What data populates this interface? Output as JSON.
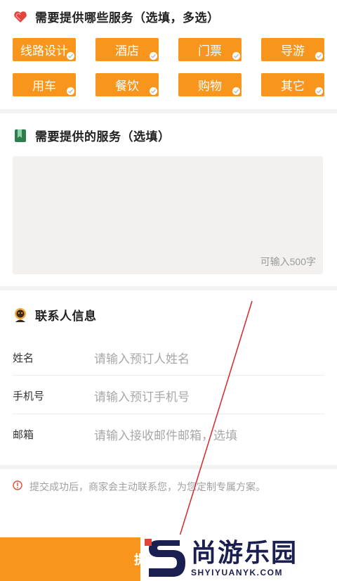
{
  "section1": {
    "title": "需要提供哪些服务（选填，多选）",
    "icon": "heart-icon",
    "tags": [
      {
        "label": "线路设计"
      },
      {
        "label": "酒店"
      },
      {
        "label": "门票"
      },
      {
        "label": "导游"
      },
      {
        "label": "用车"
      },
      {
        "label": "餐饮"
      },
      {
        "label": "购物"
      },
      {
        "label": "其它"
      }
    ]
  },
  "section2": {
    "title": "需要提供的服务（选填）",
    "icon": "bookmark-icon",
    "textarea_hint": "可输入500字"
  },
  "section3": {
    "title": "联系人信息",
    "icon": "contact-person-icon",
    "fields": [
      {
        "label": "姓名",
        "placeholder": "请输入预订人姓名"
      },
      {
        "label": "手机号",
        "placeholder": "请输入预订手机号"
      },
      {
        "label": "邮箱",
        "placeholder": "请输入接收邮件邮箱，选填"
      }
    ]
  },
  "notice": {
    "icon": "warning-icon",
    "text": "提交成功后，商家会主动联系您，为您定制专属方案。"
  },
  "bottom": {
    "submit_label": "提"
  },
  "watermark": {
    "cn": "尚游乐园",
    "en": "SHYIYUANYK.COM"
  },
  "colors": {
    "accent": "#f7951d",
    "heart": "#e2433a",
    "bookmark": "#2e7d4f",
    "contact": "#f2a93b",
    "warning": "#e24a3a",
    "annotation_line": "#d9262a",
    "watermark_text": "#1a1f4f"
  }
}
